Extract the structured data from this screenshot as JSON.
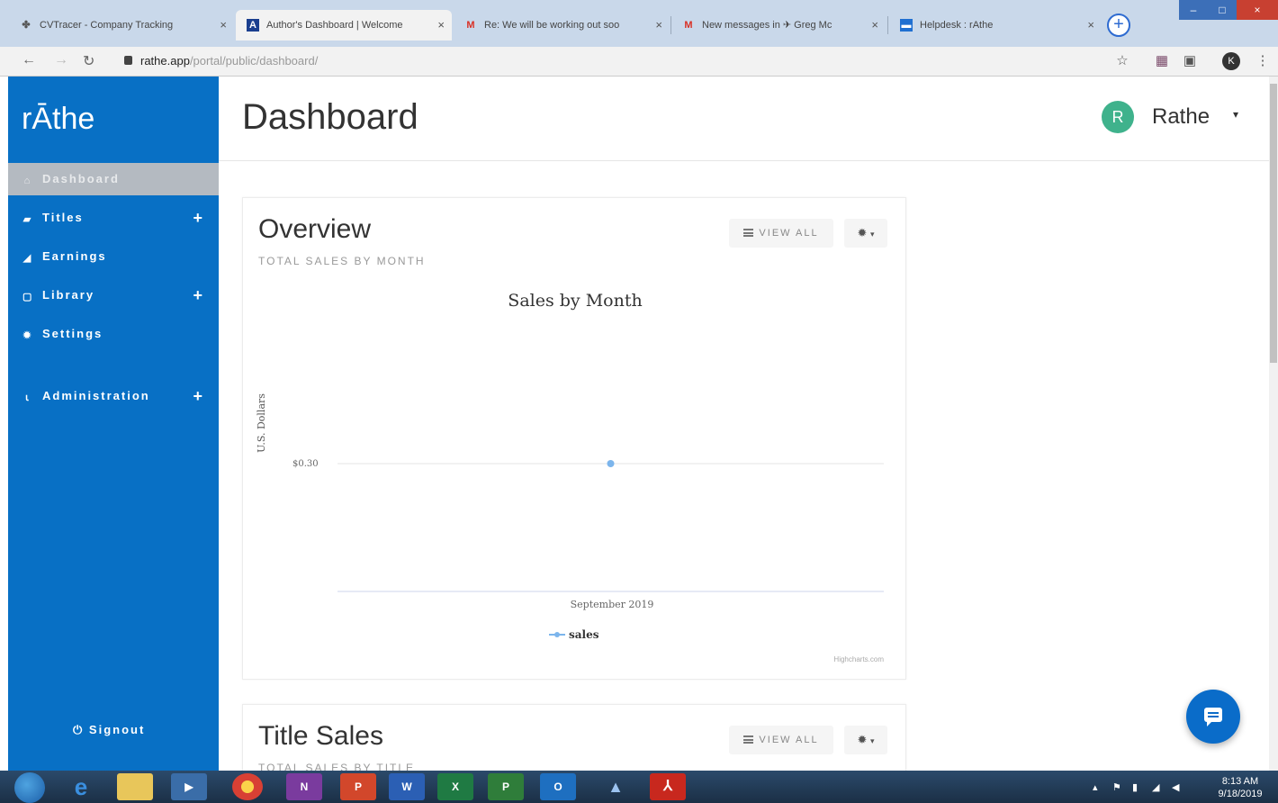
{
  "browser": {
    "tabs": [
      {
        "title": "CVTracer - Company Tracking",
        "icon": "cvtracer-favicon",
        "active": false
      },
      {
        "title": "Author's Dashboard | Welcome",
        "icon": "rathe-favicon",
        "active": true
      },
      {
        "title": "Re: We will be working out soo",
        "icon": "gmail-icon",
        "active": false
      },
      {
        "title": "New messages in ✈ Greg Mc",
        "icon": "gmail-icon",
        "active": false
      },
      {
        "title": "Helpdesk : rAthe",
        "icon": "helpdesk-favicon",
        "active": false
      }
    ],
    "url_host": "rathe.app",
    "url_path": "/portal/public/dashboard/",
    "profile_initial": "K"
  },
  "sidebar": {
    "logo": "rĀthe",
    "items": [
      {
        "label": "Dashboard",
        "icon": "home-icon",
        "active": true,
        "expandable": false
      },
      {
        "label": "Titles",
        "icon": "book-icon",
        "active": false,
        "expandable": true
      },
      {
        "label": "Earnings",
        "icon": "chart-area-icon",
        "active": false,
        "expandable": false
      },
      {
        "label": "Library",
        "icon": "file-icon",
        "active": false,
        "expandable": true
      },
      {
        "label": "Settings",
        "icon": "gear-icon",
        "active": false,
        "expandable": false
      },
      {
        "label": "Administration",
        "icon": "lock-icon",
        "active": false,
        "expandable": true
      }
    ],
    "signout": "Signout"
  },
  "header": {
    "title": "Dashboard",
    "user": {
      "initial": "R",
      "name": "Rathe",
      "avatar_color": "#3fb28c"
    }
  },
  "overview": {
    "title": "Overview",
    "subtitle": "TOTAL SALES BY MONTH",
    "view_all": "VIEW ALL"
  },
  "title_sales": {
    "title": "Title Sales",
    "subtitle": "TOTAL SALES BY TITLE",
    "view_all": "VIEW ALL"
  },
  "chart_data": {
    "type": "line",
    "title": "Sales by Month",
    "xlabel": "",
    "ylabel": "U.S. Dollars",
    "categories": [
      "September 2019"
    ],
    "series": [
      {
        "name": "sales",
        "values": [
          0.3
        ]
      }
    ],
    "y_tick_labels": [
      "$0.30"
    ],
    "legend_position": "bottom",
    "grid": true,
    "credits": "Highcharts.com",
    "series_color": "#7cb5ec"
  },
  "taskbar": {
    "apps": [
      "N",
      "P",
      "W",
      "X",
      "P",
      "O"
    ],
    "time": "8:13 AM",
    "date": "9/18/2019"
  }
}
